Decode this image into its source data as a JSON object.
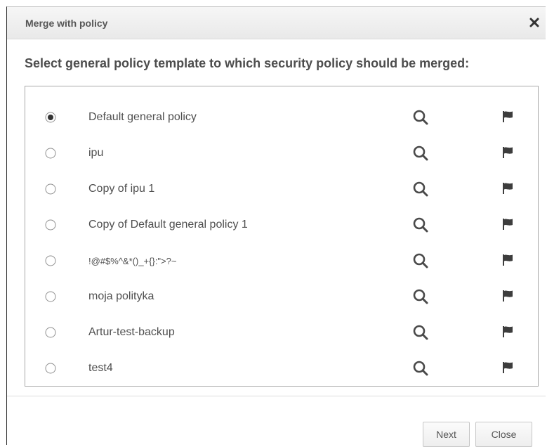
{
  "dialog": {
    "title": "Merge with policy",
    "heading": "Select general policy template to which security policy should be merged:"
  },
  "policies": [
    {
      "name": "Default general policy",
      "selected": true
    },
    {
      "name": "ipu",
      "selected": false
    },
    {
      "name": "Copy of ipu 1",
      "selected": false
    },
    {
      "name": "Copy of Default general policy 1",
      "selected": false
    },
    {
      "name": "!@#$%^&*()_+{}:\">?~",
      "selected": false
    },
    {
      "name": "moja polityka",
      "selected": false
    },
    {
      "name": "Artur-test-backup",
      "selected": false
    },
    {
      "name": "test4",
      "selected": false
    }
  ],
  "icons": {
    "close": "close-icon",
    "search": "search-icon",
    "flag": "flag-icon"
  },
  "buttons": {
    "next_label": "Next",
    "close_label": "Close"
  }
}
